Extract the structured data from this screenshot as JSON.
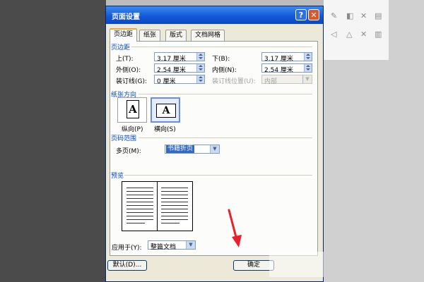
{
  "dialog": {
    "title": "页面设置",
    "help_icon": "?",
    "close_icon": "✕"
  },
  "tabs": [
    {
      "label": "页边距",
      "active": true
    },
    {
      "label": "纸张",
      "active": false
    },
    {
      "label": "版式",
      "active": false
    },
    {
      "label": "文档网格",
      "active": false
    }
  ],
  "margins": {
    "section_label": "页边距",
    "top": {
      "label": "上(T):",
      "value": "3.17 厘米"
    },
    "bottom": {
      "label": "下(B):",
      "value": "3.17 厘米"
    },
    "outside": {
      "label": "外侧(O):",
      "value": "2.54 厘米"
    },
    "inside": {
      "label": "内侧(N):",
      "value": "2.54 厘米"
    },
    "gutter": {
      "label": "装订线(G):",
      "value": "0 厘米"
    },
    "gutter_position": {
      "label": "装订线位置(U):",
      "value": "内部"
    }
  },
  "orientation": {
    "section_label": "纸张方向",
    "portrait": {
      "label": "纵向(P)",
      "glyph": "A",
      "selected": false
    },
    "landscape": {
      "label": "横向(S)",
      "glyph": "A",
      "selected": true
    }
  },
  "pages": {
    "section_label": "页码范围",
    "multiple_label": "多页(M):",
    "multiple_value": "书籍折页"
  },
  "preview": {
    "section_label": "预览",
    "apply_label": "应用于(Y):",
    "apply_value": "整篇文档"
  },
  "buttons": {
    "default": "默认(D)...",
    "ok": "确定"
  },
  "colors": {
    "titlebar": "#1459d6",
    "section_label": "#0046d5",
    "selection": "#316ac5",
    "arrow": "#e8202a"
  }
}
